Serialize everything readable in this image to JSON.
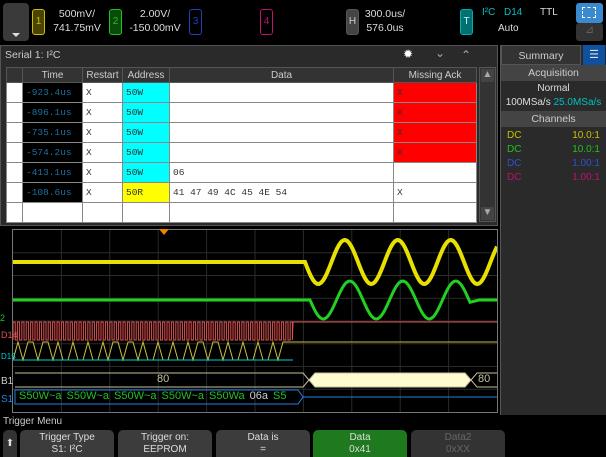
{
  "top": {
    "ch1": {
      "num": "1",
      "scale": "500mV/",
      "offset": "741.75mV",
      "color": "#c8c000"
    },
    "ch2": {
      "num": "2",
      "scale": "2.00V/",
      "offset": "-150.00mV",
      "color": "#22c022"
    },
    "ch3": {
      "num": "3",
      "color": "#2040c0"
    },
    "ch4": {
      "num": "4",
      "color": "#c01070"
    },
    "horiz": {
      "label": "H",
      "scale": "300.0us/",
      "delay": "576.0us"
    },
    "trigger": {
      "label": "T",
      "type": "I²C",
      "source": "D14",
      "level": "TTL",
      "mode": "Auto",
      "color": "#00b0b0"
    }
  },
  "serial": {
    "title": "Serial 1: I²C",
    "columns": [
      "Time",
      "Restart",
      "Address",
      "Data",
      "Missing Ack"
    ],
    "rows": [
      {
        "time": "-923.4us",
        "restart": "X",
        "address": "50W",
        "data": "",
        "ack": "X"
      },
      {
        "time": "-896.1us",
        "restart": "X",
        "address": "50W",
        "data": "",
        "ack": "X"
      },
      {
        "time": "-735.1us",
        "restart": "X",
        "address": "50W",
        "data": "",
        "ack": "X"
      },
      {
        "time": "-574.2us",
        "restart": "X",
        "address": "50W",
        "data": "",
        "ack": "X"
      },
      {
        "time": "-413.1us",
        "restart": "X",
        "address": "50W",
        "data": "06",
        "ack": ""
      },
      {
        "time": "-108.6us",
        "restart": "X",
        "address": "50R",
        "data": "41 47 49 4C 45 4E 54",
        "ack": "X"
      }
    ]
  },
  "side": {
    "tab": "Summary",
    "acquisition": "Acquisition",
    "mode": "Normal",
    "rate1": "100MSa/s",
    "rate2": "25.0MSa/s",
    "channels": "Channels",
    "chlist": [
      {
        "coupling": "DC",
        "probe": "10.0:1",
        "color": "#c8c000"
      },
      {
        "coupling": "DC",
        "probe": "10.0:1",
        "color": "#22c022"
      },
      {
        "coupling": "DC",
        "probe": "1.00:1",
        "color": "#3050d0"
      },
      {
        "coupling": "DC",
        "probe": "1.00:1",
        "color": "#c01070"
      }
    ]
  },
  "wave": {
    "labels": {
      "d14": "D14",
      "d15": "D15",
      "b1": "B1",
      "s1": "S1",
      "ch2": "2"
    },
    "bus_values": [
      "80",
      "80"
    ],
    "serial_decode": [
      "S50W~a",
      "S50W~a",
      "S50W~a",
      "S50W~a",
      "S50Wa",
      "06a",
      "S5"
    ]
  },
  "menu": {
    "title": "Trigger Menu",
    "buttons": [
      {
        "label": "Trigger Type",
        "value": "S1: I²C"
      },
      {
        "label": "Trigger on:",
        "value": "EEPROM"
      },
      {
        "label": "Data is",
        "value": "="
      },
      {
        "label": "Data",
        "value": "0x41"
      },
      {
        "label": "Data2",
        "value": "0xXX"
      }
    ]
  }
}
